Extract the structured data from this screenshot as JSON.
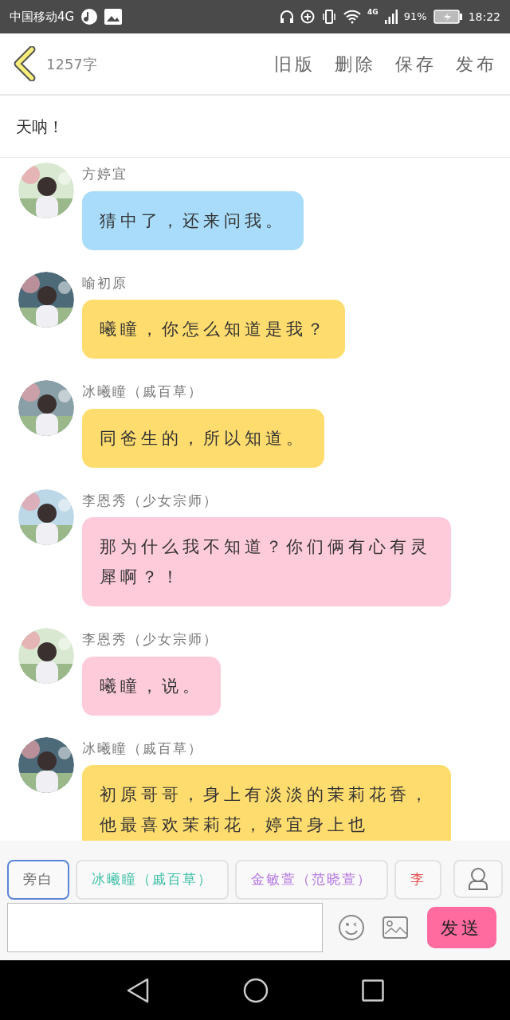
{
  "status_bar": {
    "carrier": "中国移动4G",
    "network": "4G",
    "battery": "91%",
    "time": "18:22"
  },
  "header": {
    "word_count": "1257字",
    "actions": [
      "旧版",
      "删除",
      "保存",
      "发布"
    ]
  },
  "title": "天呐！",
  "messages": [
    {
      "name": "方婷宜",
      "text": "猜中了，还来问我。",
      "color": "#a8dcfa"
    },
    {
      "name": "喻初原",
      "text": "曦瞳，你怎么知道是我？",
      "color": "#fedc6e"
    },
    {
      "name": "冰曦瞳（戚百草）",
      "text": "同爸生的，所以知道。",
      "color": "#fedc6e"
    },
    {
      "name": "李恩秀（少女宗师）",
      "text": "那为什么我不知道？你们俩有心有灵犀啊？！",
      "color": "#fecbdb"
    },
    {
      "name": "李恩秀（少女宗师）",
      "text": "曦瞳，说。",
      "color": "#fecbdb"
    },
    {
      "name": "冰曦瞳（戚百草）",
      "text": "初原哥哥，身上有淡淡的茉莉花香，他最喜欢茉莉花，婷宜身上也",
      "color": "#fedc6e"
    }
  ],
  "roles": [
    {
      "label": "旁白",
      "selected": true,
      "color": "#666666"
    },
    {
      "label": "冰曦瞳（戚百草）",
      "selected": false,
      "color": "#3bbfa6"
    },
    {
      "label": "金敏萱（范晓萱）",
      "selected": false,
      "color": "#b475e0"
    },
    {
      "label": "李",
      "selected": false,
      "color": "#e85050"
    }
  ],
  "composer": {
    "send": "发送"
  }
}
